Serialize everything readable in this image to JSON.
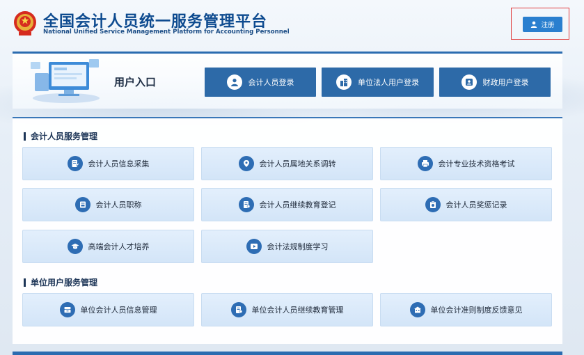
{
  "header": {
    "title_cn": "全国会计人员统一服务管理平台",
    "title_en": "National Unified Service Management Platform for Accounting Personnel",
    "register_label": "注册"
  },
  "entry": {
    "title": "用户入口",
    "buttons": [
      {
        "label": "会计人员登录",
        "icon": "person-icon"
      },
      {
        "label": "单位法人用户登录",
        "icon": "building-icon"
      },
      {
        "label": "财政用户登录",
        "icon": "finance-user-icon"
      }
    ]
  },
  "sections": [
    {
      "title": "会计人员服务管理",
      "cards": [
        {
          "label": "会计人员信息采集",
          "icon": "edit-document-icon"
        },
        {
          "label": "会计人员属地关系调转",
          "icon": "location-icon"
        },
        {
          "label": "会计专业技术资格考试",
          "icon": "printer-icon"
        },
        {
          "label": "会计人员职称",
          "icon": "title-card-icon"
        },
        {
          "label": "会计人员继续教育登记",
          "icon": "education-record-icon"
        },
        {
          "label": "会计人员奖惩记录",
          "icon": "reward-record-icon"
        },
        {
          "label": "高端会计人才培养",
          "icon": "graduation-cap-icon"
        },
        {
          "label": "会计法规制度学习",
          "icon": "play-icon"
        }
      ]
    },
    {
      "title": "单位用户服务管理",
      "cards": [
        {
          "label": "单位会计人员信息管理",
          "icon": "archive-icon"
        },
        {
          "label": "单位会计人员继续教育管理",
          "icon": "education-manage-icon"
        },
        {
          "label": "单位会计准则制度反馈意见",
          "icon": "feedback-house-icon"
        }
      ]
    }
  ],
  "colors": {
    "primary": "#2d6aa8",
    "title": "#0d4a8f",
    "card_bg": "#dce9f8",
    "highlight": "#e03a3a"
  }
}
